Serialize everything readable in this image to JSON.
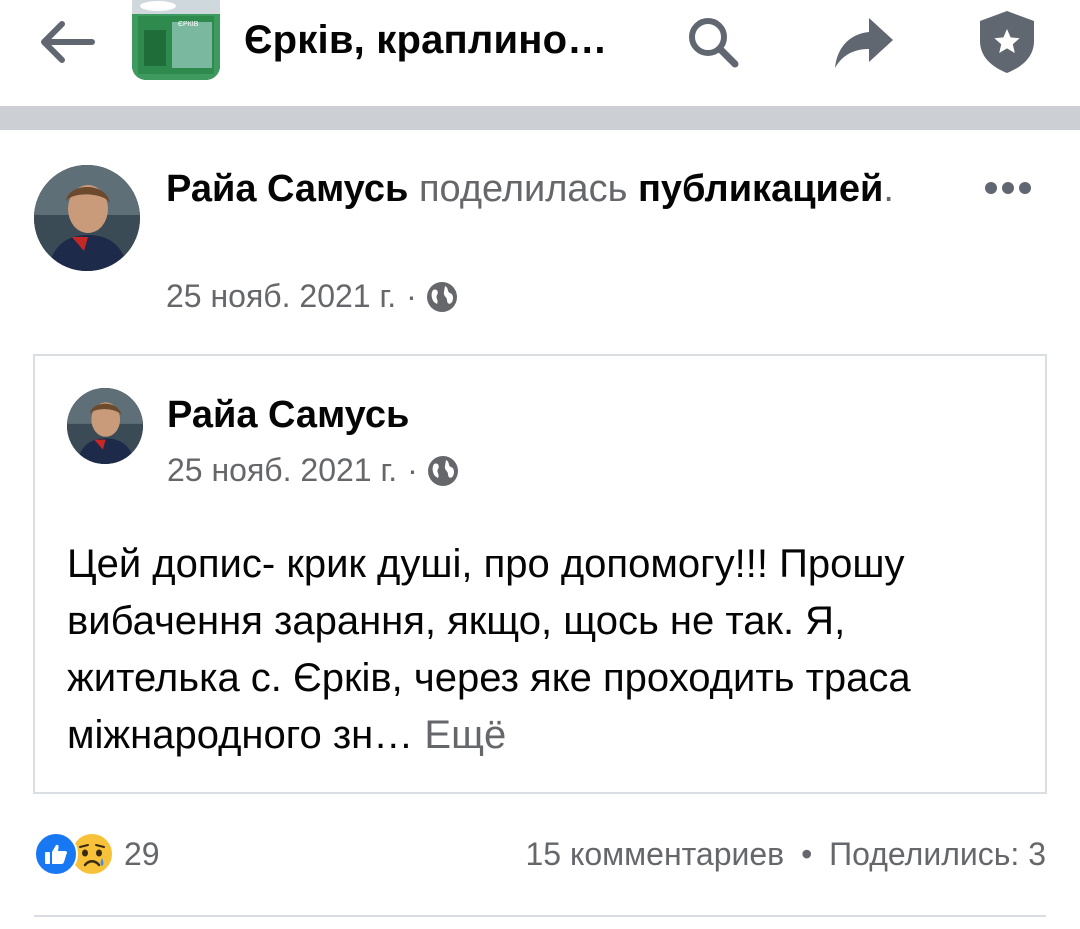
{
  "header": {
    "title": "Єрків, краплино…",
    "back_icon": "arrow-left-icon",
    "search_icon": "search-icon",
    "share_icon": "share-icon",
    "shield_icon": "shield-star-icon",
    "thumb_text": "ЄРКІВ"
  },
  "post": {
    "author": "Райа Самусь",
    "action_verb": "поделилась",
    "action_object": "публикацией",
    "period": ".",
    "date": "25 нояб. 2021 г.",
    "separator": "·",
    "audience_icon": "globe-icon",
    "more_icon": "more-horizontal-icon"
  },
  "shared": {
    "author": "Райа Самусь",
    "date": "25 нояб. 2021 г.",
    "separator": "·",
    "text": "Цей допис- крик душі, про допомогу!!! Прошу вибачення зарання, якщо, щось не так.  Я, жителька  с. Єрків, через яке проходить траса міжнародного зн…",
    "more_label": "Ещё"
  },
  "footer": {
    "reaction_count": "29",
    "comments": "15 комментариев",
    "separator": "•",
    "shares": "Поделились: 3"
  },
  "colors": {
    "primary_text": "#050505",
    "secondary_text": "#65676b",
    "divider": "#ccd0d5",
    "like_blue": "#1877f2",
    "sad_yellow": "#f7c23a"
  }
}
